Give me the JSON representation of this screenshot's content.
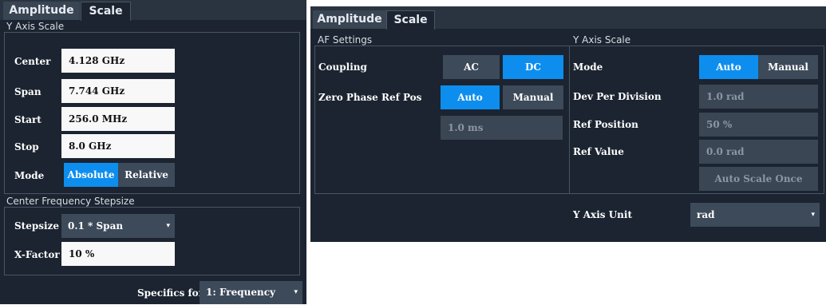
{
  "left": {
    "tabs": [
      {
        "label": "Amplitude",
        "active": false
      },
      {
        "label": "Scale",
        "active": true
      }
    ],
    "y_axis_scale": {
      "header": "Y Axis Scale",
      "center_label": "Center",
      "center_value": "4.128 GHz",
      "span_label": "Span",
      "span_value": "7.744 GHz",
      "start_label": "Start",
      "start_value": "256.0 MHz",
      "stop_label": "Stop",
      "stop_value": "8.0 GHz",
      "mode_label": "Mode",
      "mode_absolute": "Absolute",
      "mode_relative": "Relative",
      "mode_selected": "Absolute"
    },
    "stepsize": {
      "header": "Center Frequency Stepsize",
      "stepsize_label": "Stepsize",
      "stepsize_value": "0.1 * Span",
      "xfactor_label": "X-Factor",
      "xfactor_value": "10 %"
    },
    "specifics_label": "Specifics for",
    "specifics_value": "1: Frequency"
  },
  "right": {
    "tabs": [
      {
        "label": "Amplitude",
        "active": false
      },
      {
        "label": "Scale",
        "active": true
      }
    ],
    "af_settings": {
      "header": "AF Settings",
      "coupling_label": "Coupling",
      "coupling_ac": "AC",
      "coupling_dc": "DC",
      "coupling_selected": "DC",
      "zpr_label": "Zero Phase Ref Pos",
      "zpr_auto": "Auto",
      "zpr_manual": "Manual",
      "zpr_selected": "Auto",
      "zpr_value": "1.0 ms"
    },
    "y_axis_scale": {
      "header": "Y Axis Scale",
      "mode_label": "Mode",
      "mode_auto": "Auto",
      "mode_manual": "Manual",
      "mode_selected": "Auto",
      "dev_label": "Dev Per Division",
      "dev_value": "1.0 rad",
      "refpos_label": "Ref Position",
      "refpos_value": "50 %",
      "refval_label": "Ref Value",
      "refval_value": "0.0 rad",
      "auto_scale_label": "Auto Scale Once"
    },
    "y_axis_unit_label": "Y Axis Unit",
    "y_axis_unit_value": "rad"
  },
  "colors": {
    "panel_bg": "#1b2430",
    "accent_selected": "#0d8eee",
    "field_bg": "#f8f8f8",
    "disabled_field": "#3b4654"
  }
}
